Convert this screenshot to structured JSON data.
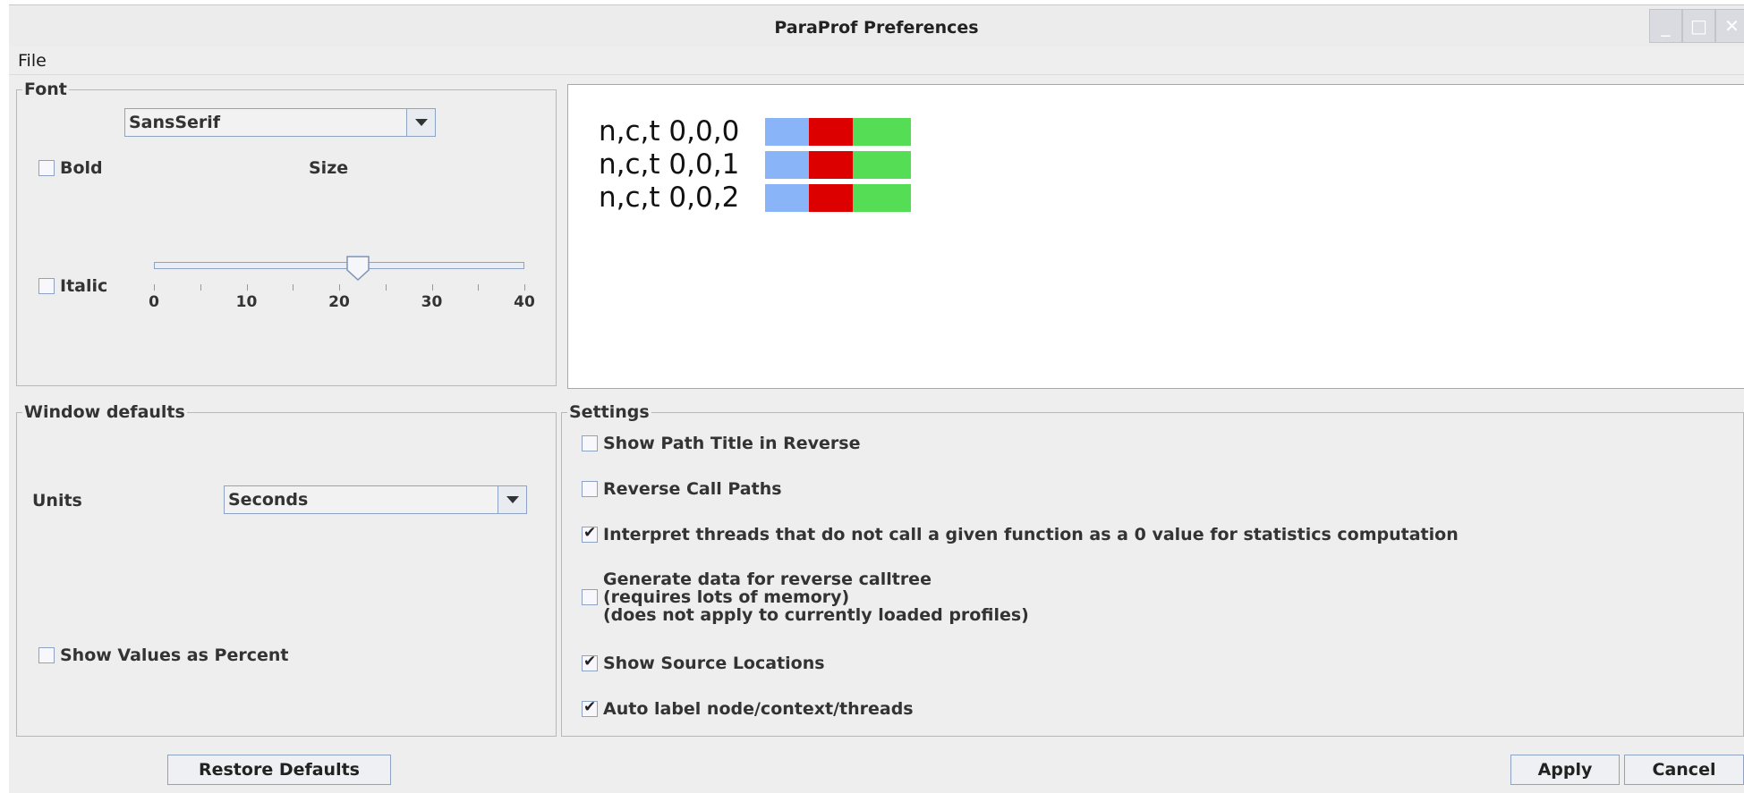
{
  "window": {
    "title": "ParaProf Preferences",
    "controls": {
      "minimize": "_",
      "maximize": "□",
      "close": "✕"
    }
  },
  "menu": {
    "file": "File"
  },
  "font_panel": {
    "legend": "Font",
    "font_family": "SansSerif",
    "bold": {
      "label": "Bold",
      "checked": false
    },
    "italic": {
      "label": "Italic",
      "checked": false
    },
    "size_label": "Size",
    "size_slider": {
      "min": 0,
      "max": 40,
      "value": 22,
      "tick_labels": [
        "0",
        "10",
        "20",
        "30",
        "40"
      ]
    }
  },
  "preview": {
    "rows": [
      {
        "label": "n,c,t 0,0,0"
      },
      {
        "label": "n,c,t 0,0,1"
      },
      {
        "label": "n,c,t 0,0,2"
      }
    ],
    "bar_colors": [
      "#8ab4f8",
      "#dd0000",
      "#55dd55"
    ]
  },
  "window_defaults": {
    "legend": "Window defaults",
    "units_label": "Units",
    "units_value": "Seconds",
    "show_percent": {
      "label": "Show Values as Percent",
      "checked": false
    }
  },
  "settings": {
    "legend": "Settings",
    "items": [
      {
        "label": "Show Path Title in Reverse",
        "checked": false
      },
      {
        "label": "Reverse Call Paths",
        "checked": false
      },
      {
        "label": "Interpret threads that do not call a given function as a 0 value for statistics computation",
        "checked": true
      },
      {
        "lines": [
          "Generate data for reverse calltree",
          "(requires lots of memory)",
          "(does not apply to currently loaded profiles)"
        ],
        "checked": false
      },
      {
        "label": "Show Source Locations",
        "checked": true
      },
      {
        "label": "Auto label node/context/threads",
        "checked": true
      }
    ]
  },
  "buttons": {
    "restore": "Restore Defaults",
    "apply": "Apply",
    "cancel": "Cancel"
  }
}
